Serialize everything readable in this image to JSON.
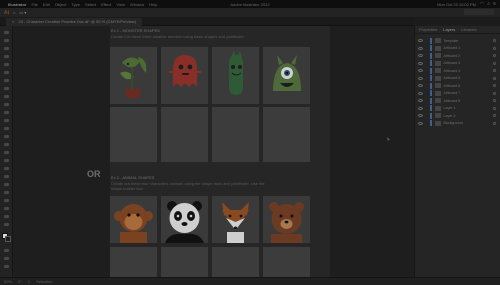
{
  "macbar": {
    "menus": [
      "Illustrator",
      "File",
      "Edit",
      "Object",
      "Type",
      "Select",
      "Effect",
      "View",
      "Window",
      "Help"
    ],
    "center_title": "Adobe Illustrator 2022",
    "clock": "Mon Oct 25  10:02 PM"
  },
  "appbar": {
    "logo": "Ai",
    "items": [
      "⌂",
      "▭ ▾"
    ]
  },
  "doc_tab": {
    "title": "24 - Character Creation Practice Doc.ai* @ 50 % (CMYK/Preview)"
  },
  "sections": [
    {
      "title": "Ex 1 - MONSTER SHAPES",
      "description": "Create Cut these three creative monster using basic shapes and pathfinder"
    },
    {
      "title": "Ex 2 - ANIMAL SHAPES",
      "description": "Create out these four characters animals using the shape tools and pathfinder. Use the",
      "description2": "shape-builder tool"
    }
  ],
  "or_label": "OR",
  "monster_icons": [
    "plant-monster-icon",
    "ghost-monster-icon",
    "cactus-monster-icon",
    "cyclops-monster-icon"
  ],
  "animal_icons": [
    "monkey-icon",
    "panda-icon",
    "fox-icon",
    "bear-icon"
  ],
  "panel": {
    "tabs": [
      "Properties",
      "Layers",
      "Libraries"
    ],
    "active_tab": "Layers",
    "layers": [
      "Template",
      "Artboard 1",
      "Artboard 2",
      "Artboard 3",
      "Artboard 4",
      "Artboard 5",
      "Artboard 6",
      "Artboard 7",
      "Artboard 8",
      "Layer 1",
      "Layer 2",
      "Background"
    ]
  },
  "status": {
    "zoom": "50%",
    "rotation": "0°",
    "artboard": "1",
    "mode": "Selection"
  },
  "colors": {
    "accent": "#3f5f8f",
    "monster_green": "#2f5a36",
    "monster_red": "#7a2a24",
    "animal_orange": "#8a4a20"
  }
}
